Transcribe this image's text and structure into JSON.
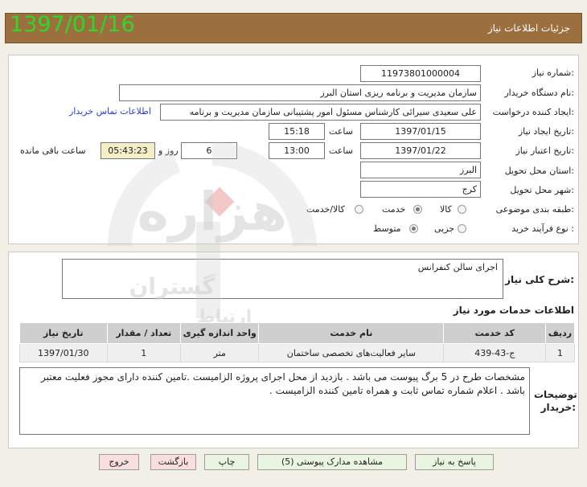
{
  "header": {
    "date": "1397/01/16",
    "title": "جزئیات اطلاعات نیاز"
  },
  "form": {
    "need_number_label": "شماره نیاز:",
    "need_number": "11973801000004",
    "buyer_org_label": "نام دستگاه خریدار:",
    "buyer_org": "سازمان مدیریت و برنامه ریزی استان البرز",
    "requester_label": "ایجاد کننده درخواست:",
    "requester": "علی سعیدی سیرائی کارشناس مسئول امور پشتیبانی سازمان مدیریت و برنامه",
    "contact_link": "اطلاعات تماس خریدار",
    "created_label": "تاریخ ایجاد نیاز:",
    "created_date": "1397/01/15",
    "time_label": "ساعت",
    "created_time": "15:18",
    "validity_label": "تاریخ اعتبار نیاز:",
    "validity_date": "1397/01/22",
    "validity_time": "13:00",
    "days_value": "6",
    "days_label": "روز و",
    "remaining_time": "05:43:23",
    "remaining_label": "ساعت باقی مانده",
    "province_label": "استان محل تحویل:",
    "province": "البرز",
    "city_label": "شهر محل تحویل:",
    "city": "کرج",
    "category_label": "طبقه بندی موضوعی:",
    "category_options": [
      "کالا",
      "خدمت",
      "کالا/خدمت"
    ],
    "category_selected": "خدمت",
    "process_label": "نوع فرآیند خرید :",
    "process_options": [
      "جزیی",
      "متوسط"
    ],
    "process_selected": "متوسط"
  },
  "summary": {
    "label": "شرح کلی نیاز:",
    "text": "اجرای سالن کنفرانس"
  },
  "services": {
    "section_title": "اطلاعات خدمات مورد نیاز",
    "columns": [
      "ردیف",
      "کد خدمت",
      "نام خدمت",
      "واحد اندازه گیری",
      "تعداد / مقدار",
      "تاریخ نیاز"
    ],
    "rows": [
      [
        "1",
        "ج-43-439",
        "سایر فعالیت‌های تخصصی ساختمان",
        "متر",
        "1",
        "1397/01/30"
      ]
    ]
  },
  "notes": {
    "label": "توضیحات خریدار:",
    "text": "مشخصات طرح در 5 برگ پیوست می باشد . بازدید از محل اجرای پروژه الزامیست .تامین کننده دارای مجوز فعلیت معتبر باشد . اعلام شماره تماس ثابت و همراه تامین کننده الزامیست ."
  },
  "buttons": {
    "reply": "پاسخ به نیاز",
    "attachments": "مشاهده مدارک پیوستی (5)",
    "print": "چاپ",
    "back": "بازگشت",
    "exit": "خروج"
  },
  "watermark": {
    "text1": "هزاره",
    "text2": "گستران",
    "text3": "ارتباط"
  },
  "colors": {
    "header_bg": "#9c6f3f",
    "date_green": "#2ed82a",
    "link_blue": "#2a3fd1",
    "highlight": "#f3edc8",
    "button_green": "#e9f5e1",
    "button_red": "#f8dede"
  }
}
